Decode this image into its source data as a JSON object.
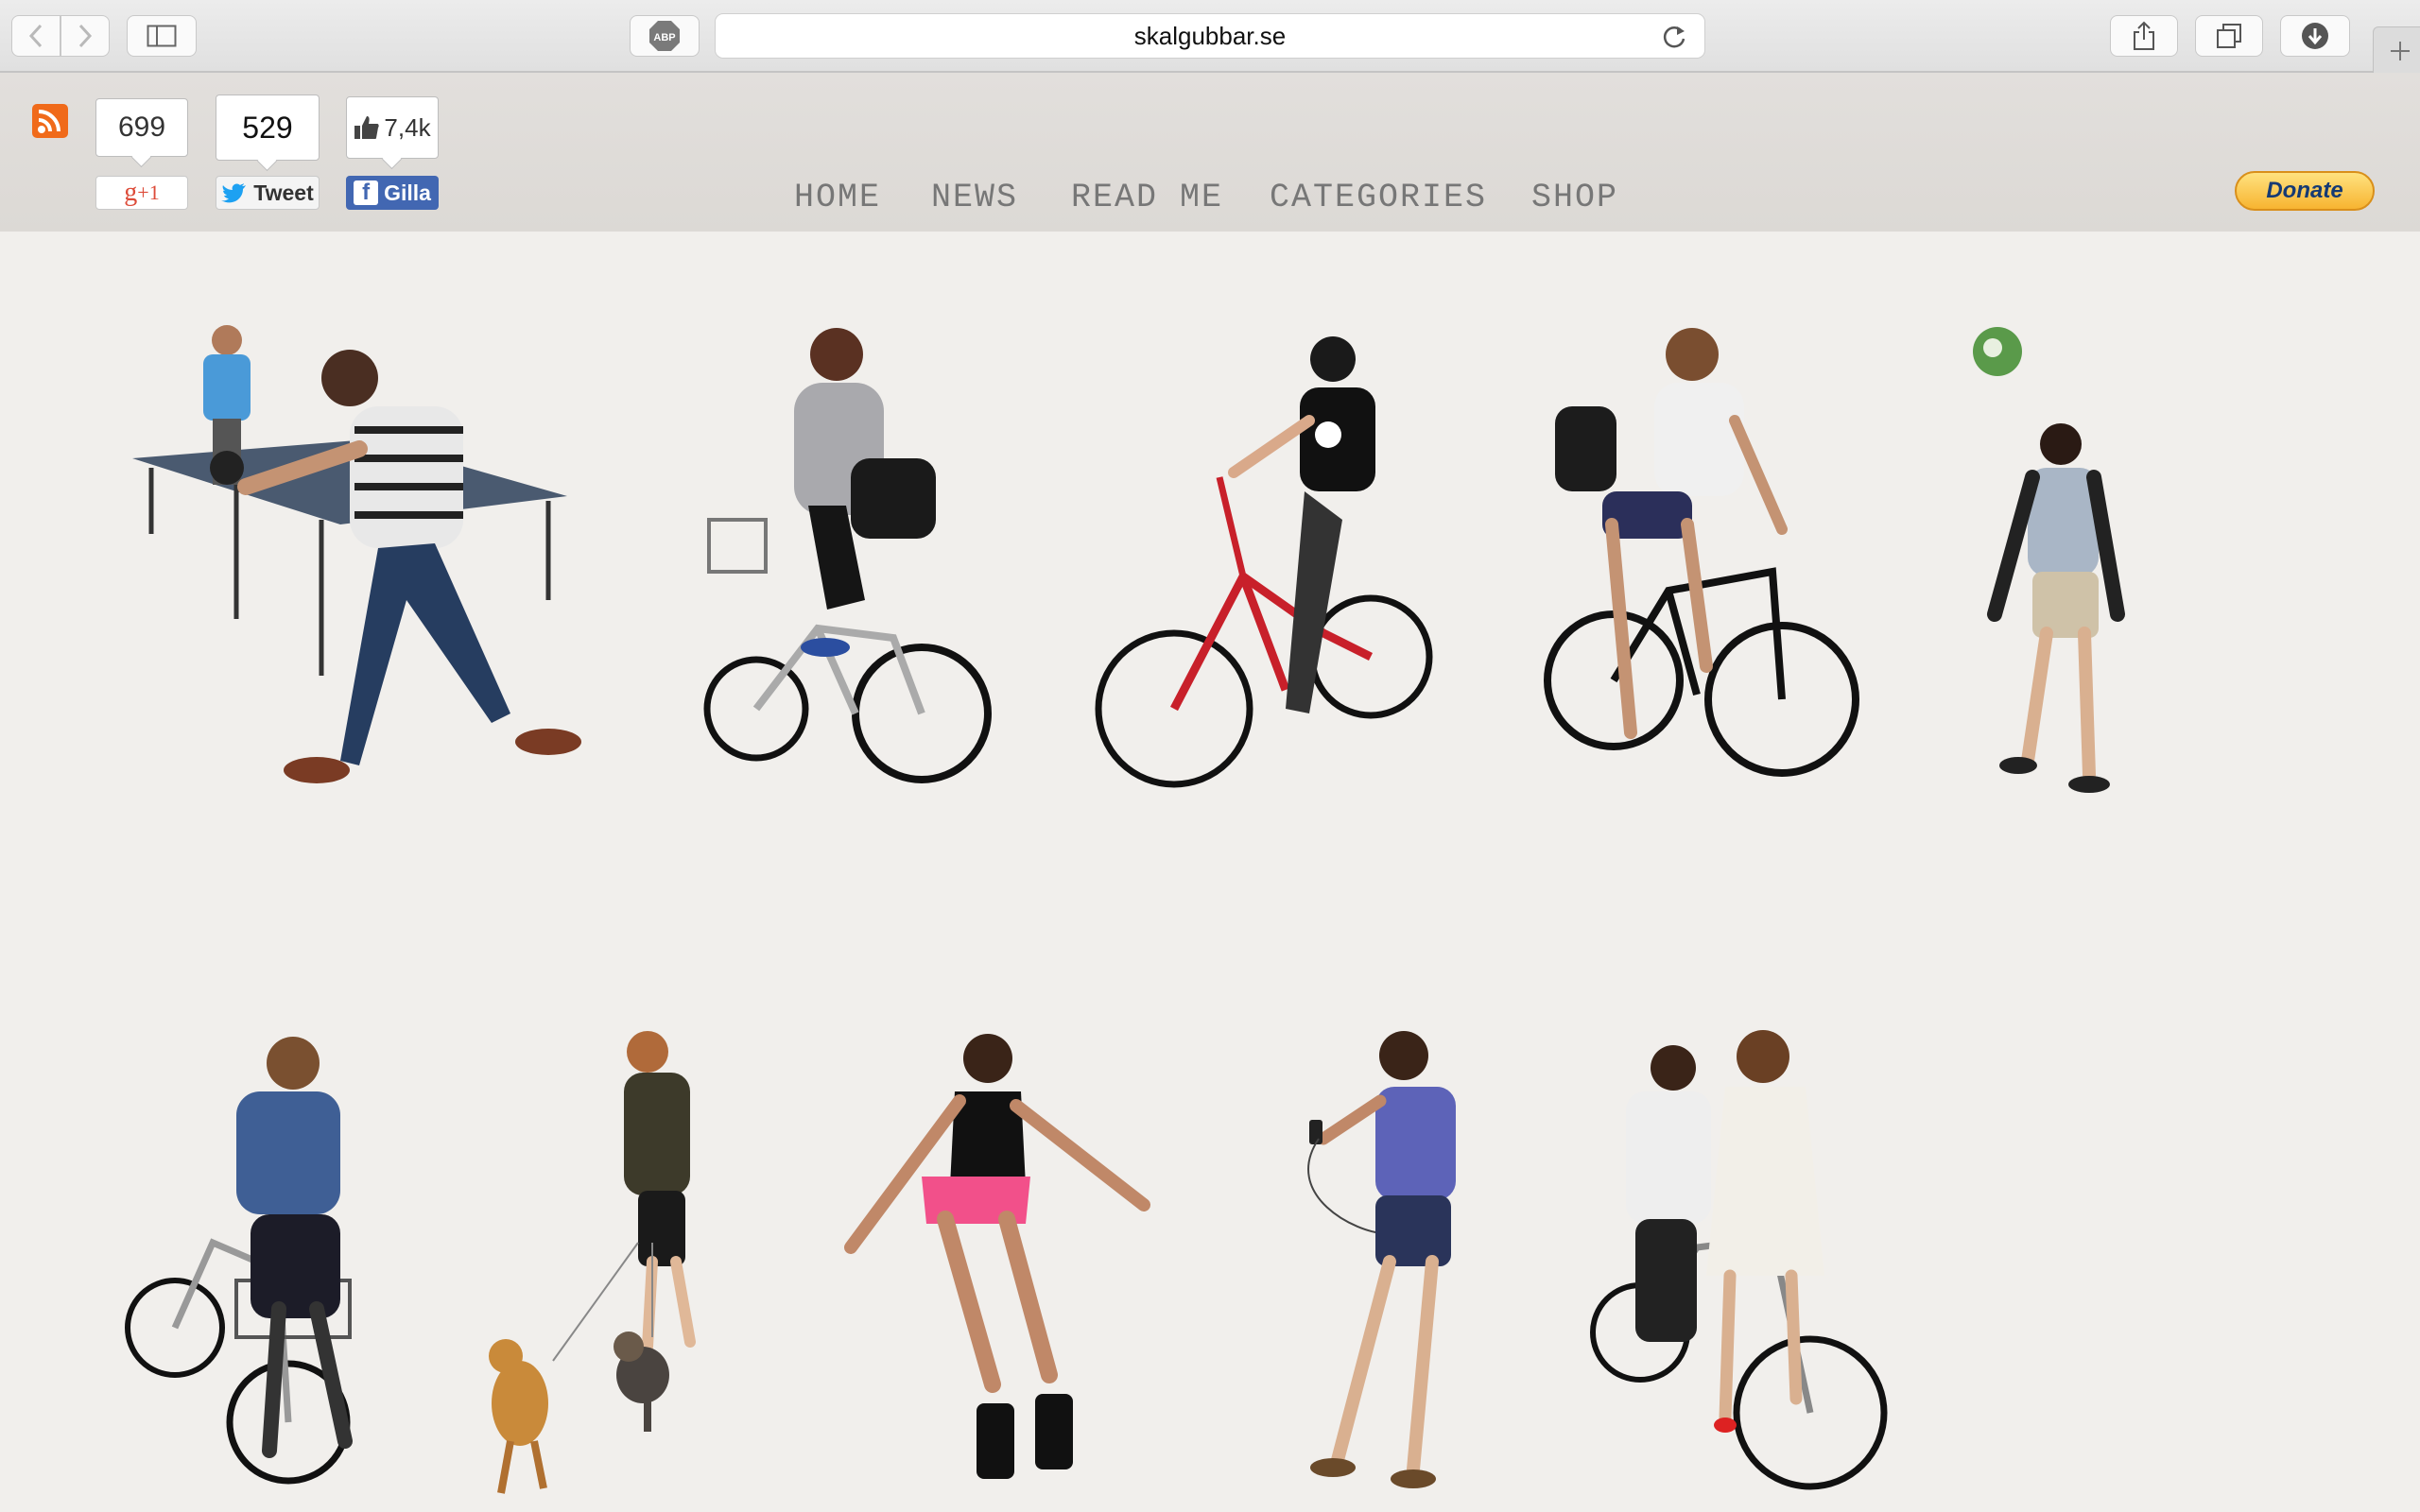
{
  "browser": {
    "url": "skalgubbar.se",
    "adblock_label": "ABP"
  },
  "social": {
    "gplus_count": "699",
    "gplus_label": "+1",
    "gplus_g": "g",
    "tweet_count": "529",
    "tweet_label": "Tweet",
    "like_count": "7,4k",
    "facebook_label": "Gilla",
    "facebook_f": "f"
  },
  "nav": {
    "items": [
      "HOME",
      "NEWS",
      "READ ME",
      "CATEGORIES",
      "SHOP"
    ]
  },
  "donate": {
    "label": "Donate"
  },
  "colors": {
    "rss": "#f06a1a",
    "facebook": "#4267b2",
    "twitter": "#1da1f2",
    "gplus": "#dd4b39",
    "donate": "#f7b431"
  },
  "gallery": {
    "row1": [
      {
        "subject": "ping-pong player"
      },
      {
        "subject": "cyclist with messenger bag"
      },
      {
        "subject": "woman on red bicycle"
      },
      {
        "subject": "cyclist with backpack"
      },
      {
        "subject": "man heading football"
      }
    ],
    "row2": [
      {
        "subject": "man walking bicycle"
      },
      {
        "subject": "man walking dogs"
      },
      {
        "subject": "woman rollerblading"
      },
      {
        "subject": "man with headphones"
      },
      {
        "subject": "couple with bicycle"
      }
    ]
  }
}
